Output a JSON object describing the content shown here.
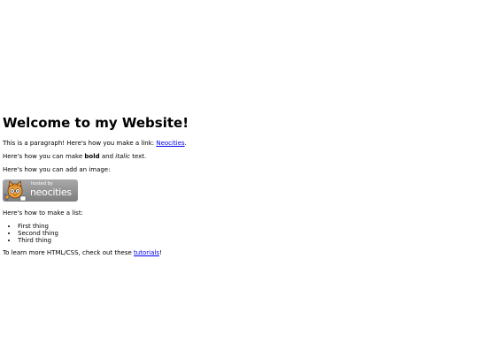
{
  "heading": "Welcome to my Website!",
  "para1": {
    "text": "This is a paragraph! Here's how you make a link: ",
    "link": "Neocities",
    "end": "."
  },
  "para2": {
    "before": "Here's how you can make ",
    "bold": "bold",
    "middle": " and ",
    "italic": "italic",
    "after": " text."
  },
  "para3": "Here's how you can add an image:",
  "badge": {
    "hosted": "hosted by",
    "name": "neocities",
    "icon": "neocities-cat-icon"
  },
  "para4": "Here's how to make a list:",
  "list": [
    "First thing",
    "Second thing",
    "Third thing"
  ],
  "para5": {
    "text": "To learn more HTML/CSS, check out these ",
    "link": "tutorials",
    "end": "!"
  },
  "colors": {
    "link": "#0000ee",
    "badge_bg": "#8c8c8c"
  }
}
